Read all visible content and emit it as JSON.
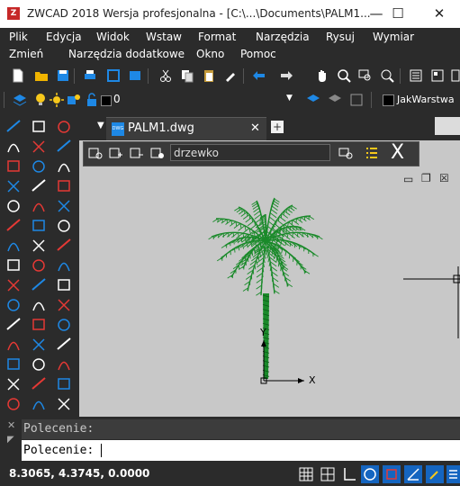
{
  "window": {
    "title": "ZWCAD 2018 Wersja profesjonalna - [C:\\...\\Documents\\PALM1...",
    "app_icon_text": "Z",
    "minimize_glyph": "—",
    "maximize_glyph": "☐",
    "close_glyph": "✕"
  },
  "menu": {
    "row1": [
      "Plik",
      "Edycja",
      "Widok",
      "Wstaw",
      "Format",
      "Narzędzia",
      "Rysuj",
      "Wymiar"
    ],
    "row2": [
      "Zmień",
      "Narzędzia dodatkowe",
      "Okno",
      "Pomoc"
    ]
  },
  "layer_toolbar": {
    "current_layer": "0",
    "color_name": "JakWarstwa",
    "dropdown_glyph": "▼"
  },
  "document_tab": {
    "name": "PALM1.dwg",
    "close_glyph": "✕",
    "new_tab_glyph": "+",
    "menu_glyph": "▼"
  },
  "block_editor": {
    "block_name": "drzewko",
    "close_glyph": "X"
  },
  "viewport_controls": {
    "minimize": "▭",
    "restore": "❐",
    "close": "☒"
  },
  "ucs": {
    "x_label": "X",
    "y_label": "Y"
  },
  "command": {
    "history_line": "Polecenie:",
    "prompt": "Polecenie:"
  },
  "status": {
    "coordinates": "8.3065, 4.3745, 0.0000"
  },
  "colors": {
    "background": "#2b2b2b",
    "canvas": "#c8c8c8",
    "palm_green": "#1a8a2a",
    "accent_blue": "#1e88e5"
  }
}
